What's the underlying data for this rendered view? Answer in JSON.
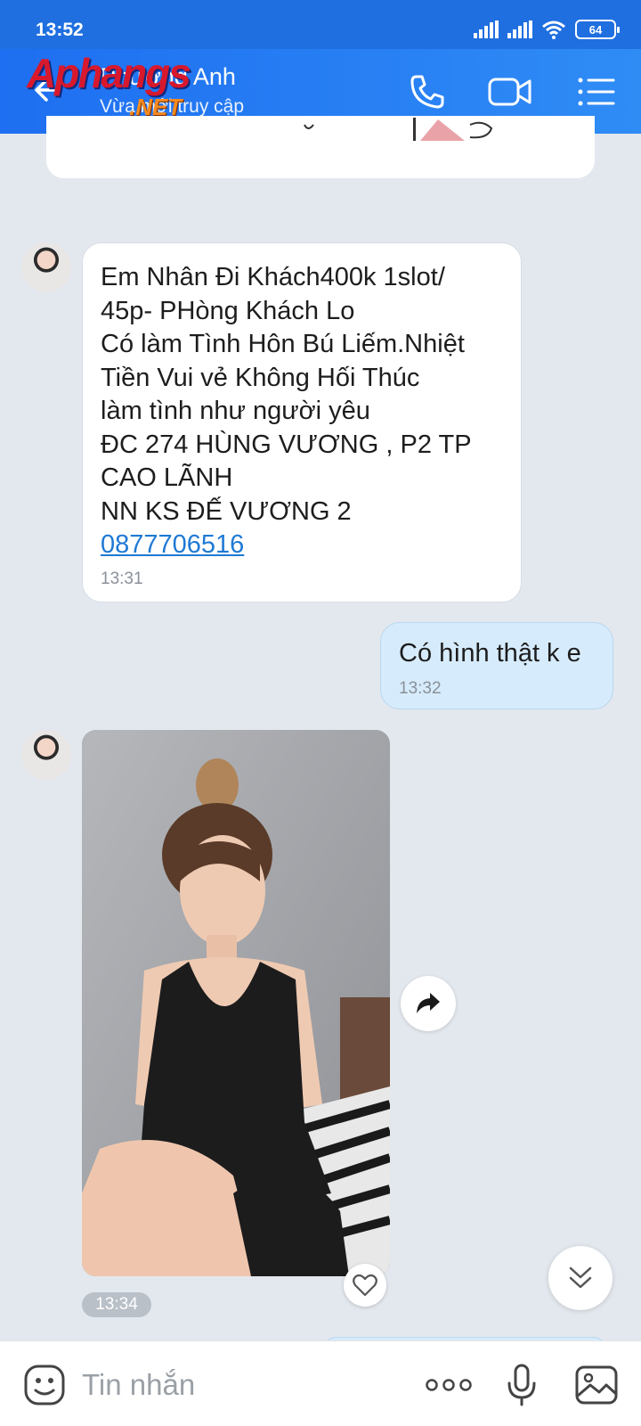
{
  "status_bar": {
    "time": "13:52",
    "battery": "64"
  },
  "header": {
    "contact_name": "Phương Anh",
    "contact_status": "Vừa mới truy cập",
    "watermark": "Aphangs",
    "watermark_suffix": ".NET"
  },
  "messages": {
    "incoming_text": {
      "lines": [
        "Em Nhân Đi Khách400k 1slot/",
        "45p- PHòng Khách Lo",
        "Có làm Tình Hôn Bú Liếm.Nhiệt",
        "Tiền Vui vẻ Không Hối Thúc",
        "làm tình như người yêu",
        "ĐC 274 HÙNG VƯƠNG , P2 TP",
        "CAO LÃNH",
        "NN KS ĐẾ VƯƠNG 2"
      ],
      "phone": "0877706516",
      "time": "13:31"
    },
    "outgoing_text": {
      "text": "Có hình thật k e",
      "time": "13:32"
    },
    "incoming_photo": {
      "time": "13:34"
    }
  },
  "input_bar": {
    "placeholder": "Tin nhắn"
  },
  "colors": {
    "header_blue": "#1e6ff1",
    "link_blue": "#1e79d4",
    "outgoing_bubble": "#d6ebfb"
  }
}
